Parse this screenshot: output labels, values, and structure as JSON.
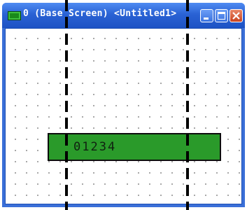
{
  "window": {
    "title": "0 (Base Screen) <Untitled1>",
    "icon": "screen-icon",
    "controls": [
      "minimize-icon",
      "maximize-icon",
      "close-icon"
    ]
  },
  "canvas": {
    "background": "#ffffff",
    "grid": "dotted"
  },
  "display_object": {
    "value": "01234",
    "fill_color": "#2a9a2a",
    "border_color": "#0d0d0d"
  },
  "colors": {
    "titlebar": "#2a62d4",
    "close_button": "#c9431f"
  }
}
